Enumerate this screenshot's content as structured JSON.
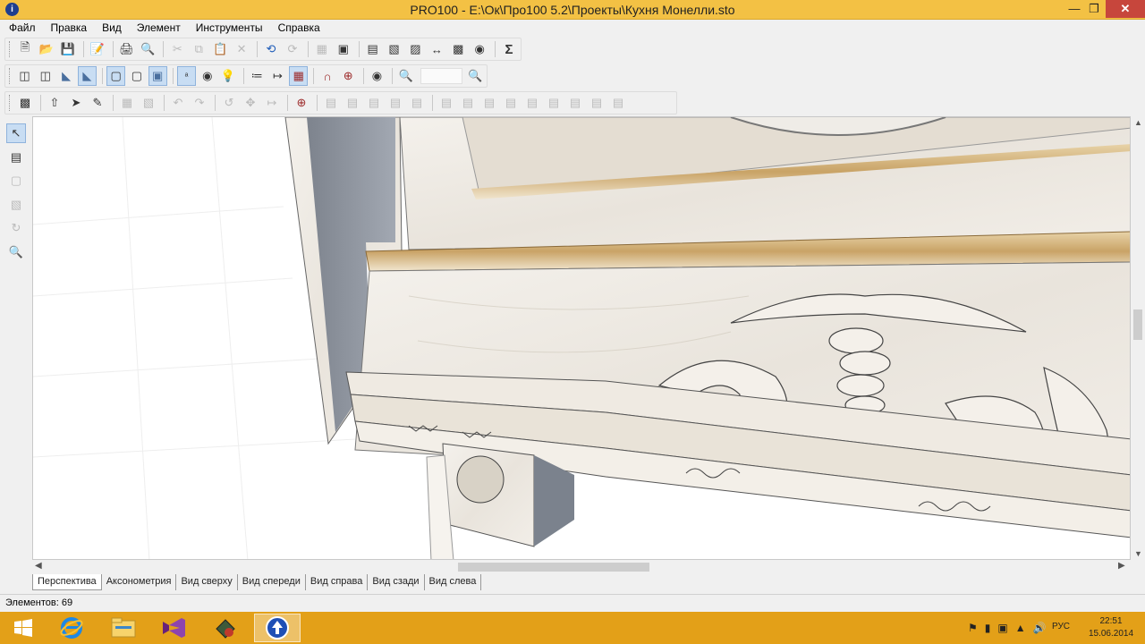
{
  "window": {
    "title": "PRO100 - E:\\Ок\\Про100 5.2\\Проекты\\Кухня Монелли.sto",
    "app_icon": "pro100-logo-icon"
  },
  "menu": {
    "items": [
      {
        "label": "Файл"
      },
      {
        "label": "Правка"
      },
      {
        "label": "Вид"
      },
      {
        "label": "Элемент"
      },
      {
        "label": "Инструменты"
      },
      {
        "label": "Справка"
      }
    ]
  },
  "toolbar1": {
    "sigma_label": "Σ"
  },
  "view_tabs": [
    {
      "label": "Перспектива",
      "active": true
    },
    {
      "label": "Аксонометрия"
    },
    {
      "label": "Вид сверху"
    },
    {
      "label": "Вид спереди"
    },
    {
      "label": "Вид справа"
    },
    {
      "label": "Вид сзади"
    },
    {
      "label": "Вид слева"
    }
  ],
  "status": {
    "elements": "Элементов: 69"
  },
  "taskbar": {
    "lang": "РУС",
    "time": "22:51",
    "date": "15.06.2014"
  },
  "colors": {
    "titlebar": "#f3c144",
    "taskbar": "#e3a018",
    "close": "#c7463c"
  }
}
